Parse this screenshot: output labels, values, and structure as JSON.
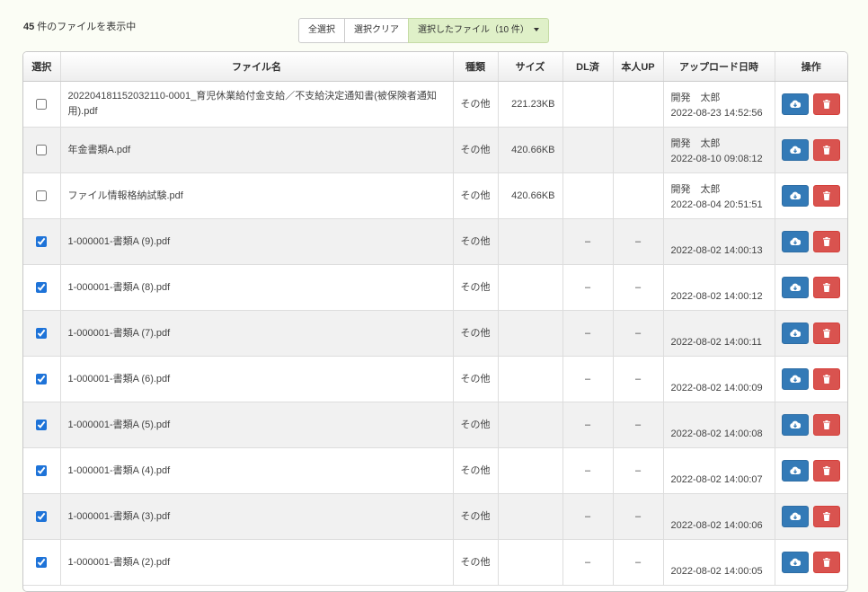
{
  "summary": {
    "count": "45",
    "suffix": " 件のファイルを表示中"
  },
  "selection": {
    "select_all": "全選択",
    "clear": "選択クリア",
    "selected_files": "選択したファイル（10 件）"
  },
  "table": {
    "headers": {
      "select": "選択",
      "name": "ファイル名",
      "type": "種類",
      "size": "サイズ",
      "dl": "DL済",
      "self_up": "本人UP",
      "uploaded": "アップロード日時",
      "ops": "操作"
    },
    "rows": [
      {
        "checked": false,
        "name": "20220418115203211​0-0001_育児休業給付金支給／不支給決定通知書(被保険者通知用).pdf",
        "type": "その他",
        "size": "221.23KB",
        "dl": "",
        "self_up": "",
        "uploader": "開発　太郎",
        "date": "2022-08-23 14:52:56"
      },
      {
        "checked": false,
        "name": "年金書類A.pdf",
        "type": "その他",
        "size": "420.66KB",
        "dl": "",
        "self_up": "",
        "uploader": "開発　太郎",
        "date": "2022-08-10 09:08:12"
      },
      {
        "checked": false,
        "name": "ファイル情報格納試験.pdf",
        "type": "その他",
        "size": "420.66KB",
        "dl": "",
        "self_up": "",
        "uploader": "開発　太郎",
        "date": "2022-08-04 20:51:51"
      },
      {
        "checked": true,
        "name": "1-000001-書類A (9).pdf",
        "type": "その他",
        "size": "",
        "dl": "–",
        "self_up": "–",
        "uploader": "",
        "date": "2022-08-02 14:00:13"
      },
      {
        "checked": true,
        "name": "1-000001-書類A (8).pdf",
        "type": "その他",
        "size": "",
        "dl": "–",
        "self_up": "–",
        "uploader": "",
        "date": "2022-08-02 14:00:12"
      },
      {
        "checked": true,
        "name": "1-000001-書類A (7).pdf",
        "type": "その他",
        "size": "",
        "dl": "–",
        "self_up": "–",
        "uploader": "",
        "date": "2022-08-02 14:00:11"
      },
      {
        "checked": true,
        "name": "1-000001-書類A (6).pdf",
        "type": "その他",
        "size": "",
        "dl": "–",
        "self_up": "–",
        "uploader": "",
        "date": "2022-08-02 14:00:09"
      },
      {
        "checked": true,
        "name": "1-000001-書類A (5).pdf",
        "type": "その他",
        "size": "",
        "dl": "–",
        "self_up": "–",
        "uploader": "",
        "date": "2022-08-02 14:00:08"
      },
      {
        "checked": true,
        "name": "1-000001-書類A (4).pdf",
        "type": "その他",
        "size": "",
        "dl": "–",
        "self_up": "–",
        "uploader": "",
        "date": "2022-08-02 14:00:07"
      },
      {
        "checked": true,
        "name": "1-000001-書類A (3).pdf",
        "type": "その他",
        "size": "",
        "dl": "–",
        "self_up": "–",
        "uploader": "",
        "date": "2022-08-02 14:00:06"
      },
      {
        "checked": true,
        "name": "1-000001-書類A (2).pdf",
        "type": "その他",
        "size": "",
        "dl": "–",
        "self_up": "–",
        "uploader": "",
        "date": "2022-08-02 14:00:05"
      }
    ]
  },
  "icons": {
    "download": "cloud-download-icon",
    "delete": "trash-icon"
  },
  "colors": {
    "download_btn": "#337ab7",
    "delete_btn": "#d9534f",
    "selected_group": "#dff0c8",
    "checkbox": "#1e73d8"
  }
}
